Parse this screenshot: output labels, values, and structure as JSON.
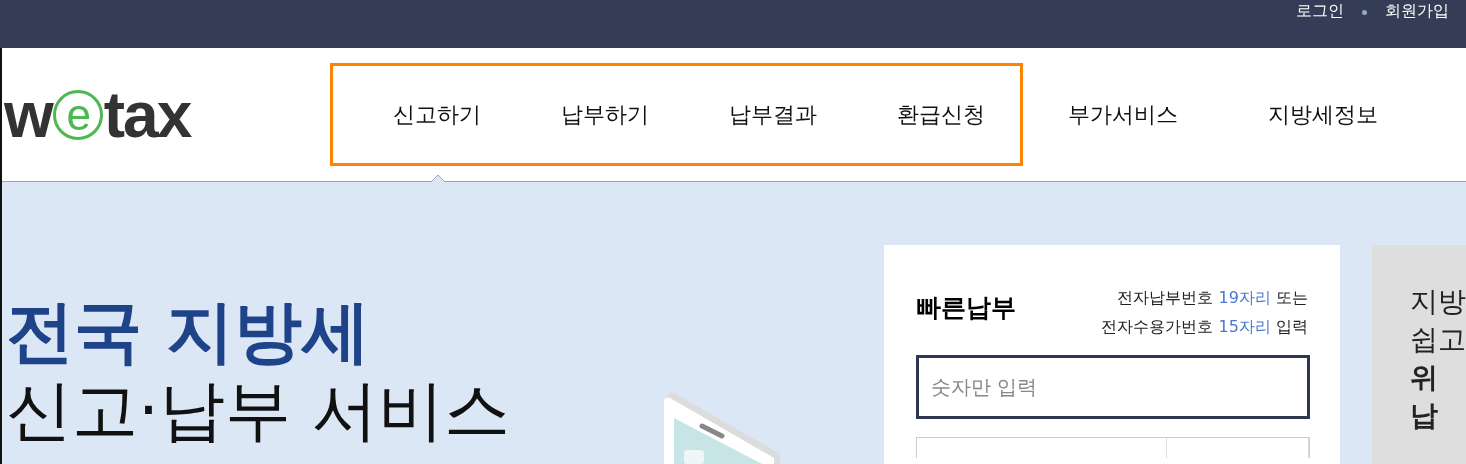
{
  "top_bar": {
    "links": [
      "로그인",
      "회원가입"
    ]
  },
  "header": {
    "logo": "wetax",
    "nav": [
      {
        "label": "신고하기",
        "highlighted": true
      },
      {
        "label": "납부하기",
        "highlighted": true
      },
      {
        "label": "납부결과",
        "highlighted": true
      },
      {
        "label": "환급신청",
        "highlighted": true
      },
      {
        "label": "부가서비스",
        "highlighted": false
      },
      {
        "label": "지방세정보",
        "highlighted": false
      }
    ]
  },
  "hero": {
    "title": "전국 지방세",
    "subtitle": "신고·납부 서비스"
  },
  "quick_pay": {
    "title": "빠른납부",
    "hint_lines": [
      "전자납부번호 **19자리** 또는",
      "전자수용가번호 **15자리** 입력"
    ],
    "input": {
      "placeholder": "숫자만 입력"
    }
  },
  "side_panel": {
    "lines": [
      {
        "text": "지방",
        "bold": false
      },
      {
        "text": "쉽고",
        "bold": false
      },
      {
        "text": "위",
        "bold": true
      },
      {
        "text": "납",
        "bold": true
      }
    ]
  }
}
